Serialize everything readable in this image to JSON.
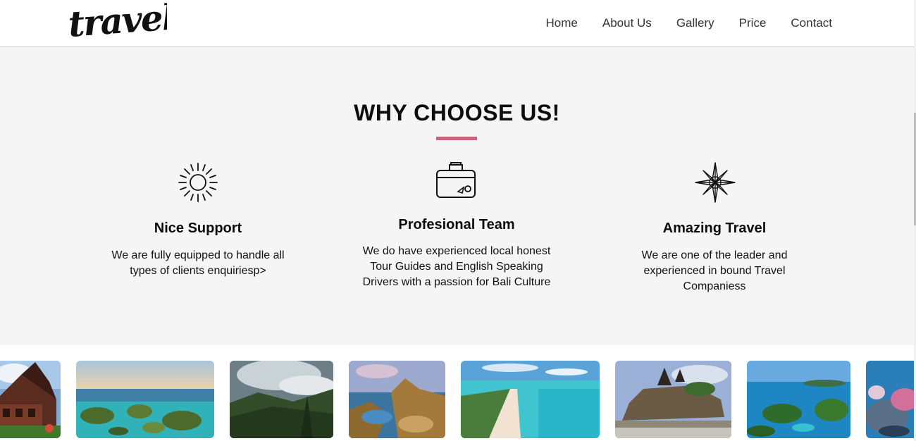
{
  "header": {
    "logo_text": "travel",
    "nav": [
      "Home",
      "About Us",
      "Gallery",
      "Price",
      "Contact"
    ]
  },
  "why": {
    "title": "WHY CHOOSE US!",
    "accent_color": "#c8637a",
    "features": [
      {
        "icon": "sun-icon",
        "title": "Nice Support",
        "text": "We are fully equipped to handle all types of clients enquiriesp>"
      },
      {
        "icon": "suitcase-icon",
        "title": "Profesional Team",
        "text": "We do have experienced local honest Tour Guides and English Speaking Drivers with a passion for Bali Culture"
      },
      {
        "icon": "compass-rose-icon",
        "title": "Amazing Travel",
        "text": "We are one of the leader and experienced in bound Travel Companiess"
      }
    ]
  },
  "gallery": {
    "images": [
      "traditional-house-photo",
      "islands-lagoon-photo",
      "jungle-valley-photo",
      "padar-island-photo",
      "white-sand-beach-photo",
      "tanah-lot-temple-photo",
      "tropical-islands-photo",
      "coral-reef-photo"
    ]
  }
}
